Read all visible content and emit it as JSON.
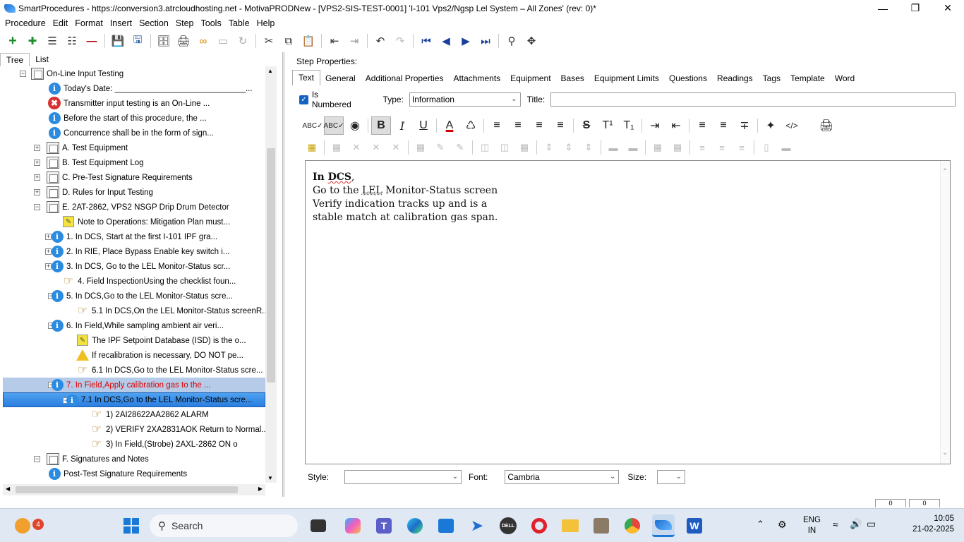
{
  "window": {
    "title": "SmartProcedures - https://conversion3.atrcloudhosting.net - MotivaPRODNew - [VPS2-SIS-TEST-0001] 'I-101 Vps2/Ngsp Lel System – All Zones' (rev: 0)*"
  },
  "menu": [
    "Procedure",
    "Edit",
    "Format",
    "Insert",
    "Section",
    "Step",
    "Tools",
    "Table",
    "Help"
  ],
  "left_tabs": {
    "tree": "Tree",
    "list": "List"
  },
  "tree": [
    {
      "label": "On-Line Input Testing",
      "icon": "document-icon",
      "expander": "−"
    },
    {
      "label": "Today's Date: _____________________________...",
      "icon": "info-icon"
    },
    {
      "label": "Transmitter input testing is an On-Line ...",
      "icon": "error-icon"
    },
    {
      "label": "Before the start of this procedure, the ...",
      "icon": "info-icon"
    },
    {
      "label": "Concurrence shall be in the form of sign...",
      "icon": "info-icon"
    },
    {
      "label": "A. Test Equipment",
      "icon": "section-icon",
      "expander": "+"
    },
    {
      "label": "B. Test Equipment Log",
      "icon": "section-icon",
      "expander": "+"
    },
    {
      "label": "C. Pre-Test Signature Requirements",
      "icon": "section-icon",
      "expander": "+"
    },
    {
      "label": "D. Rules for Input Testing",
      "icon": "section-icon",
      "expander": "+"
    },
    {
      "label": "E. 2AT-2862, VPS2 NSGP Drip Drum Detector",
      "icon": "section-icon",
      "expander": "−"
    },
    {
      "label": "Note to Operations: Mitigation Plan must...",
      "icon": "note-icon"
    },
    {
      "label": "1. In DCS, Start at the first I-101 IPF gra...",
      "icon": "info-icon",
      "expander": "+"
    },
    {
      "label": "2. In RIE, Place Bypass Enable key switch i...",
      "icon": "info-icon",
      "expander": "+"
    },
    {
      "label": "3. In DCS, Go to the LEL Monitor-Status scr...",
      "icon": "info-icon",
      "expander": "+"
    },
    {
      "label": "4. Field InspectionUsing the checklist foun...",
      "icon": "hand-icon"
    },
    {
      "label": "5. In DCS,Go to the LEL Monitor-Status scre...",
      "icon": "info-icon",
      "expander": "−"
    },
    {
      "label": "5.1 In DCS,On the LEL Monitor-Status screenR...",
      "icon": "hand-icon"
    },
    {
      "label": "6. In Field,While sampling ambient air veri...",
      "icon": "info-icon",
      "expander": "−"
    },
    {
      "label": "The IPF Setpoint Database (ISD) is the o...",
      "icon": "note-icon"
    },
    {
      "label": "If recalibration is necessary, DO NOT pe...",
      "icon": "warning-icon"
    },
    {
      "label": "6.1 In DCS,Go to the LEL Monitor-Status scre...",
      "icon": "hand-icon"
    },
    {
      "label": "7. In Field,Apply calibration gas to the ...",
      "icon": "info-icon",
      "expander": "−"
    },
    {
      "label": "7.1 In DCS,Go to the LEL Monitor-Status scre...",
      "icon": "info-icon",
      "expander": "−"
    },
    {
      "label": "1) 2AI28622AA2862 ALARM",
      "icon": "hand-icon"
    },
    {
      "label": "2) VERIFY 2XA2831AOK Return to Normal...",
      "icon": "hand-icon"
    },
    {
      "label": "3) In Field,(Strobe) 2AXL-2862 ON o",
      "icon": "hand-icon"
    },
    {
      "label": "F. Signatures and Notes",
      "icon": "section-icon",
      "expander": "−"
    },
    {
      "label": "Post-Test Signature Requirements",
      "icon": "info-icon"
    }
  ],
  "step_properties": {
    "heading": "Step Properties:",
    "tabs": [
      "Text",
      "General",
      "Additional Properties",
      "Attachments",
      "Equipment",
      "Bases",
      "Equipment Limits",
      "Questions",
      "Readings",
      "Tags",
      "Template",
      "Word"
    ],
    "is_numbered_label": "Is Numbered",
    "type_label": "Type:",
    "type_value": "Information",
    "title_label": "Title:",
    "title_value": ""
  },
  "editor": {
    "line1_bold": "In DCS",
    "line1_tail": ",",
    "line2": "Go to the LEL Monitor-Status screen",
    "line3": "Verify indication tracks up and is a",
    "line4": "stable match at calibration gas span."
  },
  "bottom": {
    "style_label": "Style:",
    "style_value": "",
    "font_label": "Font:",
    "font_value": "Cambria",
    "size_label": "Size:",
    "size_value": ""
  },
  "statusbar": {
    "panel1": "0",
    "panel2": "0"
  },
  "taskbar": {
    "search_placeholder": "Search",
    "widgets_badge": "4",
    "lang1": "ENG",
    "lang2": "IN",
    "time": "10:05",
    "date": "21-02-2025"
  }
}
